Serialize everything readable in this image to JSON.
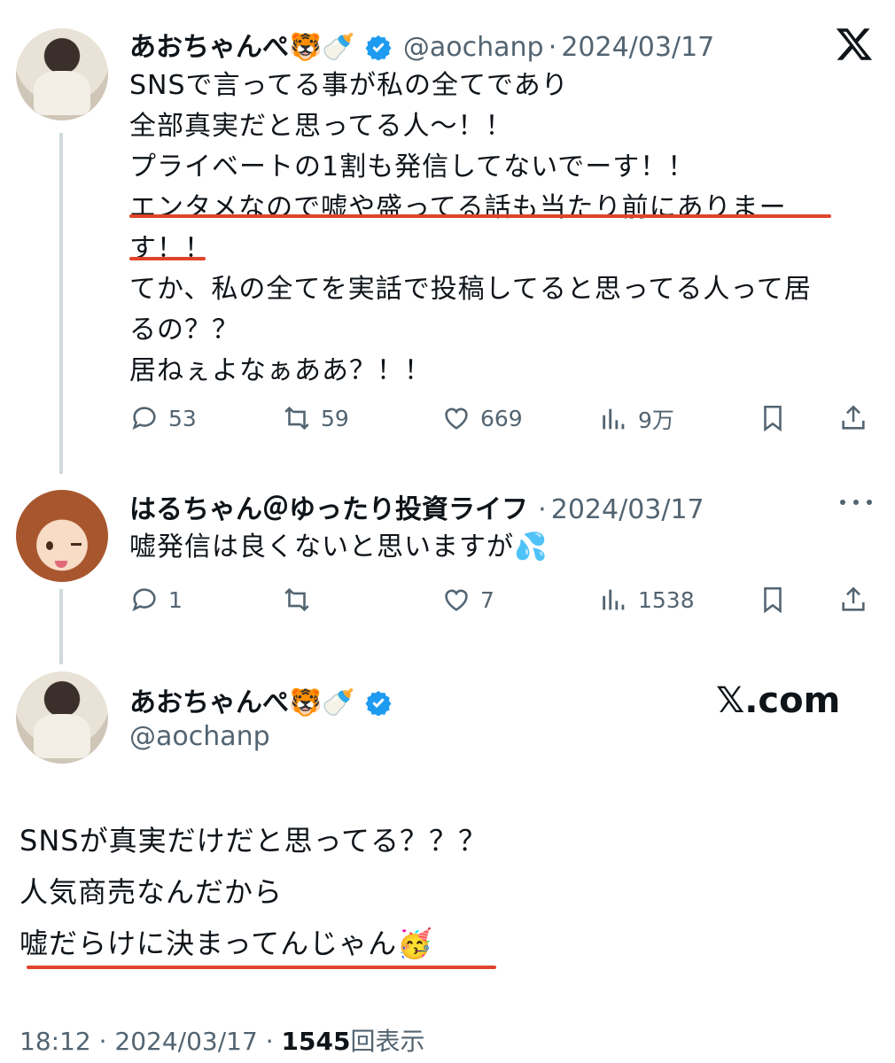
{
  "tweet1": {
    "display_name": "あおちゃんぺ🐯🍼",
    "handle": "@aochanp",
    "separator": "·",
    "date": "2024/03/17",
    "lines": [
      "SNSで言ってる事が私の全てであり",
      "全部真実だと思ってる人〜！！",
      "プライベートの1割も発信してないでーす！！",
      "エンタメなので嘘や盛ってる話も当たり前にありまー",
      "す！！",
      "てか、私の全てを実話で投稿してると思ってる人って居",
      "るの？？",
      "居ねぇよなぁああ？！！"
    ],
    "replies": "53",
    "reposts": "59",
    "likes": "669",
    "views": "9万"
  },
  "tweet2": {
    "display_name": "はるちゃん＠ゆったり投資ライフ",
    "separator": "·",
    "date": "2024/03/17",
    "text": "嘘発信は良くないと思いますが💦",
    "replies": "1",
    "reposts": "",
    "likes": "7",
    "views": "1538"
  },
  "tweet3": {
    "display_name": "あおちゃんぺ🐯🍼",
    "handle": "@aochanp",
    "brand": "𝕏.com",
    "lines": [
      "SNSが真実だけだと思ってる？？？",
      "人気商売なんだから",
      "嘘だらけに決まってんじゃん🥳"
    ],
    "time": "18:12",
    "separator": "·",
    "date": "2024/03/17",
    "separator2": "·",
    "view_count": "1545",
    "view_label": "回表示"
  },
  "colors": {
    "accent_blue": "#1d9bf0",
    "underline_red": "#e0442a",
    "muted": "#536471",
    "thread_line": "#cfd9de"
  },
  "icons": [
    "x-logo-icon",
    "verified-badge-icon",
    "reply-icon",
    "repost-icon",
    "like-icon",
    "views-icon",
    "bookmark-icon",
    "share-icon",
    "more-icon"
  ]
}
